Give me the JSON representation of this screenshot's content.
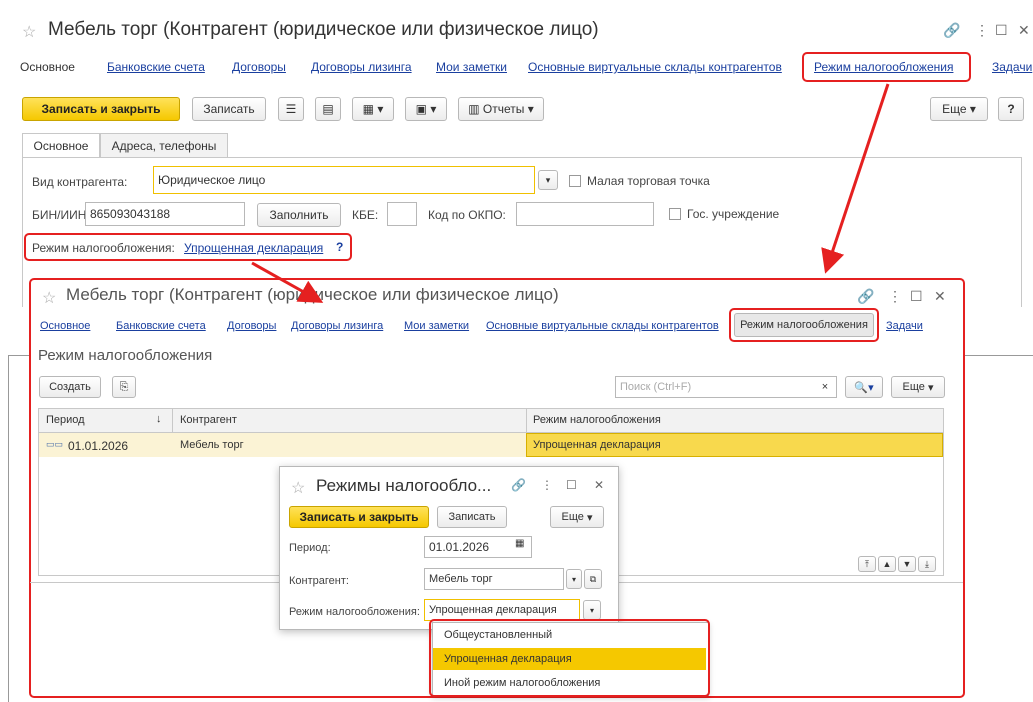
{
  "main": {
    "title": "Мебель торг (Контрагент (юридическое или физическое лицо)",
    "nav": [
      "Основное",
      "Банковские счета",
      "Договоры",
      "Договоры лизинга",
      "Мои заметки",
      "Основные виртуальные склады контрагентов",
      "Режим налогообложения",
      "Задачи"
    ],
    "buttons": {
      "save_close": "Записать и закрыть",
      "save": "Записать",
      "reports": "Отчеты",
      "more": "Еще",
      "help": "?"
    },
    "tabs": [
      "Основное",
      "Адреса, телефоны"
    ],
    "type_label": "Вид контрагента:",
    "type_value": "Юридическое лицо",
    "small_shop": "Малая торговая точка",
    "bin_label": "БИН/ИИН:",
    "bin_value": "865093043188",
    "fill": "Заполнить",
    "kbe": "КБЕ:",
    "okpo": "Код по ОКПО:",
    "gov": "Гос. учреждение",
    "tax_label": "Режим налогообложения:",
    "tax_link": "Упрощенная декларация",
    "tax_q": "?"
  },
  "second": {
    "title": "Мебель торг (Контрагент (юридическое или физическое лицо)",
    "nav": [
      "Основное",
      "Банковские счета",
      "Договоры",
      "Договоры лизинга",
      "Мои заметки",
      "Основные виртуальные склады контрагентов",
      "Режим налогообложения",
      "Задачи"
    ],
    "section": "Режим налогообложения",
    "create": "Создать",
    "search_placeholder": "Поиск (Ctrl+F)",
    "more": "Еще",
    "columns": [
      "Период",
      "Контрагент",
      "Режим налогообложения"
    ],
    "sort_arrow": "↓",
    "row": {
      "period": "01.01.2026",
      "counterparty": "Мебель торг",
      "regime": "Упрощенная декларация"
    }
  },
  "dialog": {
    "title": "Режимы налогообло...",
    "save_close": "Записать и закрыть",
    "save": "Записать",
    "more": "Еще",
    "period_label": "Период:",
    "period_value": "01.01.2026",
    "cp_label": "Контрагент:",
    "cp_value": "Мебель торг",
    "regime_label": "Режим налогообложения:",
    "regime_value": "Упрощенная декларация",
    "options": [
      "Общеустановленный",
      "Упрощенная декларация",
      "Иной режим налогообложения"
    ],
    "selected_option": 1
  },
  "colors": {
    "accent_yellow": "#f5c800",
    "highlight_red": "#e52020",
    "link_blue": "#1a3f9f"
  }
}
